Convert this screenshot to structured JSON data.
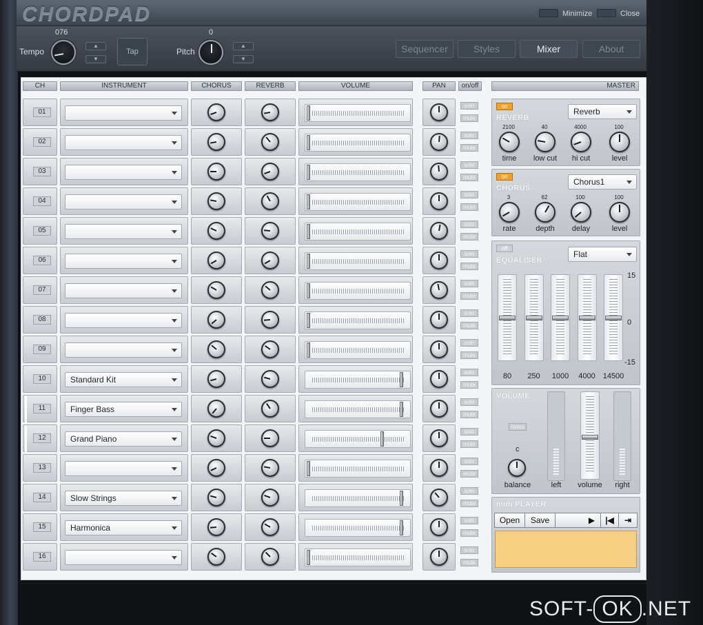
{
  "app": {
    "logo": "CHORDPAD",
    "minimize": "Minimize",
    "close": "Close"
  },
  "controls": {
    "tempo_label": "Tempo",
    "tempo_value": "076",
    "tap_label": "Tap",
    "pitch_label": "Pitch",
    "pitch_value": "0"
  },
  "nav": [
    {
      "label": "Sequencer",
      "active": false
    },
    {
      "label": "Styles",
      "active": false
    },
    {
      "label": "Mixer",
      "active": true
    },
    {
      "label": "About",
      "active": false
    }
  ],
  "headers": {
    "ch": "CH",
    "instrument": "INSTRUMENT",
    "chorus": "CHORUS",
    "reverb": "REVERB",
    "volume": "VOLUME",
    "pan": "PAN",
    "onoff": "on/off",
    "master": "MASTER"
  },
  "row_buttons": {
    "solo": "solo",
    "mute": "mute"
  },
  "channels": [
    {
      "num": "01",
      "instrument": "",
      "volume": 0.0
    },
    {
      "num": "02",
      "instrument": "",
      "volume": 0.0
    },
    {
      "num": "03",
      "instrument": "",
      "volume": 0.0
    },
    {
      "num": "04",
      "instrument": "",
      "volume": 0.0
    },
    {
      "num": "05",
      "instrument": "",
      "volume": 0.0
    },
    {
      "num": "06",
      "instrument": "",
      "volume": 0.0
    },
    {
      "num": "07",
      "instrument": "",
      "volume": 0.0
    },
    {
      "num": "08",
      "instrument": "",
      "volume": 0.0
    },
    {
      "num": "09",
      "instrument": "",
      "volume": 0.0
    },
    {
      "num": "10",
      "instrument": "Standard Kit",
      "volume": 0.95
    },
    {
      "num": "11",
      "instrument": "Finger Bass",
      "volume": 0.95
    },
    {
      "num": "12",
      "instrument": "Grand Piano",
      "volume": 0.75
    },
    {
      "num": "13",
      "instrument": "",
      "volume": 0.0
    },
    {
      "num": "14",
      "instrument": "Slow Strings",
      "volume": 0.95
    },
    {
      "num": "15",
      "instrument": "Harmonica",
      "volume": 0.95
    },
    {
      "num": "16",
      "instrument": "",
      "volume": 0.0
    }
  ],
  "master": {
    "reverb": {
      "on_label": "on",
      "title": "REVERB",
      "preset": "Reverb",
      "knobs": [
        {
          "value": "2100",
          "label": "time"
        },
        {
          "value": "40",
          "label": "low cut"
        },
        {
          "value": "4000",
          "label": "hi cut"
        },
        {
          "value": "100",
          "label": "level"
        }
      ]
    },
    "chorus": {
      "on_label": "on",
      "title": "CHORUS",
      "preset": "Chorus1",
      "knobs": [
        {
          "value": "3",
          "label": "rate"
        },
        {
          "value": "62",
          "label": "depth"
        },
        {
          "value": "100",
          "label": "delay"
        },
        {
          "value": "100",
          "label": "level"
        }
      ]
    },
    "equaliser": {
      "off_label": "off",
      "title": "EQUALISER",
      "preset": "Flat",
      "scale_top": "15",
      "scale_mid": "0",
      "scale_bottom": "-15",
      "bands": [
        "80",
        "250",
        "1000",
        "4000",
        "14500"
      ]
    },
    "volume": {
      "title": "VOLUME",
      "mono_label": "mono",
      "balance_value": "c",
      "balance_label": "balance",
      "left_label": "left",
      "volume_label": "volume",
      "right_label": "right",
      "level": 0.5
    },
    "midi": {
      "title": "midi PLAYER",
      "open": "Open",
      "save": "Save"
    }
  },
  "watermark": {
    "left": "SOFT-",
    "box": "OK",
    "right": ".NET"
  }
}
